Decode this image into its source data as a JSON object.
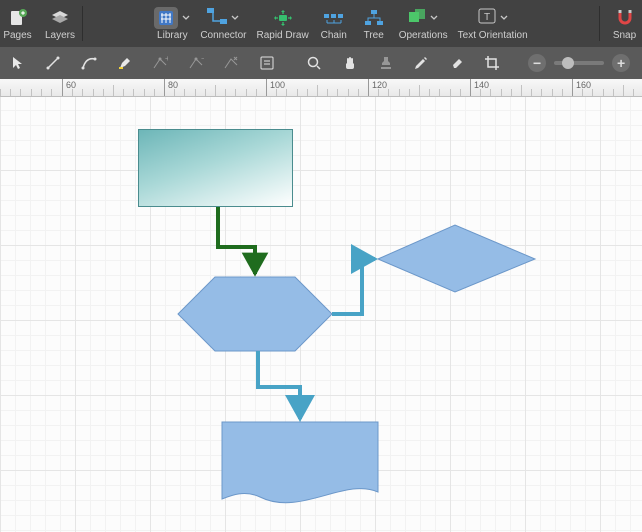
{
  "toolbar1": {
    "pages": "Pages",
    "layers": "Layers",
    "library": "Library",
    "connector": "Connector",
    "rapid_draw": "Rapid Draw",
    "chain": "Chain",
    "tree": "Tree",
    "operations": "Operations",
    "text_orientation": "Text Orientation",
    "snap": "Snap"
  },
  "ruler": {
    "ticks": [
      60,
      80,
      100,
      120,
      140,
      160
    ]
  },
  "zoom": {
    "value": 20
  },
  "colors": {
    "toolbar_bg": "#424242",
    "shape_blue": "#95bce6",
    "shape_blue_border": "#6b97c9",
    "connector_teal": "#48a3c6",
    "connector_green": "#1f6c1e"
  }
}
